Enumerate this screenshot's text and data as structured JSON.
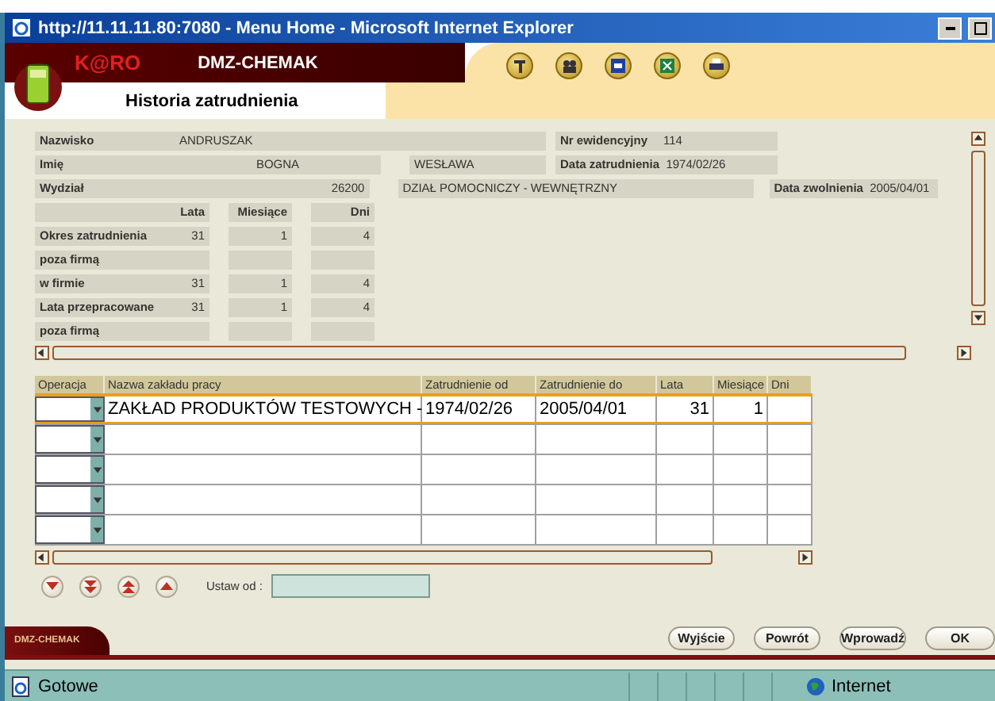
{
  "window": {
    "title": "http://11.11.11.80:7080 - Menu Home - Microsoft Internet Explorer"
  },
  "header": {
    "brand": "K@RO",
    "app": "DMZ-CHEMAK",
    "page_title": "Historia zatrudnienia"
  },
  "employee": {
    "surname": {
      "label": "Nazwisko",
      "value": "ANDRUSZAK"
    },
    "first_name": {
      "label": "Imię",
      "value": "BOGNA"
    },
    "second_name": {
      "value": "WESŁAWA"
    },
    "department": {
      "label": "Wydział",
      "value": "26200"
    },
    "department_name": {
      "value": "DZIAŁ POMOCNICZY - WEWNĘTRZNY"
    },
    "id_number": {
      "label": "Nr ewidencyjny",
      "value": "114"
    },
    "hire_date": {
      "label": "Data zatrudnienia",
      "value": "1974/02/26"
    },
    "leave_date": {
      "label": "Data zwolnienia",
      "value": "2005/04/01"
    }
  },
  "period_table": {
    "columns": [
      "Lata",
      "Miesiące",
      "Dni"
    ],
    "rows": [
      {
        "label": "Okres zatrudnienia",
        "values": [
          "31",
          "1",
          "4"
        ]
      },
      {
        "label": "poza firmą"
      },
      {
        "label": "w firmie",
        "values": [
          "31",
          "1",
          "4"
        ]
      },
      {
        "label": "Lata przepracowane",
        "values": [
          "31",
          "1",
          "4"
        ]
      },
      {
        "label": "poza firmą"
      }
    ]
  },
  "history_table": {
    "columns": [
      "Operacja",
      "Nazwa zakładu pracy",
      "Zatrudnienie od",
      "Zatrudnienie do",
      "Lata",
      "Miesiące",
      "Dni"
    ],
    "rows": [
      {
        "selected": true,
        "cells": [
          "ZAKŁAD PRODUKTÓW TESTOWYCH -",
          "1974/02/26",
          "2005/04/01",
          "31",
          "1"
        ]
      },
      {
        "selected": false
      },
      {
        "selected": false
      },
      {
        "selected": false
      },
      {
        "selected": false
      }
    ]
  },
  "navigation": {
    "set_from_label": "Ustaw od :"
  },
  "footer": {
    "tab": "DMZ-CHEMAK",
    "buttons": [
      "Wyjście",
      "Powrót",
      "Wprowadź",
      "OK"
    ]
  },
  "status_bar": {
    "text": "Gotowe",
    "zone": "Internet"
  }
}
